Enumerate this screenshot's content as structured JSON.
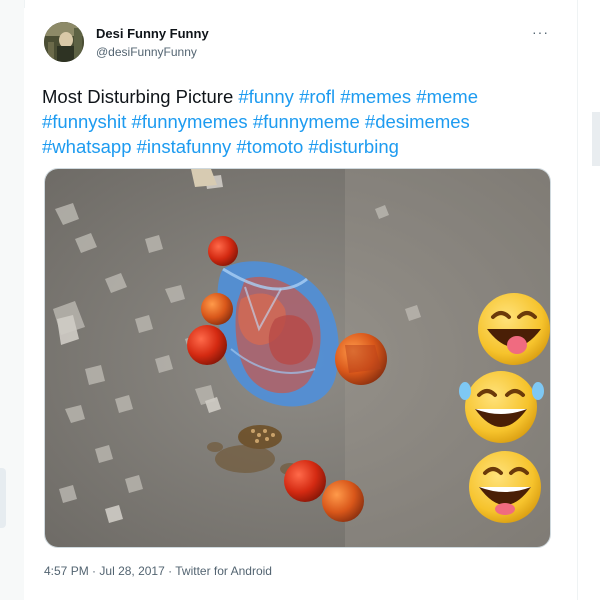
{
  "tweet": {
    "author_name": "Desi Funny Funny",
    "author_handle": "@desiFunnyFunny",
    "more_label": "···",
    "text_intro": "Most Disturbing Picture",
    "hashtags": [
      "#funny",
      "#rofl",
      "#memes",
      "#meme",
      "#funnyshit",
      "#funnymemes",
      "#funnymeme",
      "#desimemes",
      "#whatsapp",
      "#instafunny",
      "#tomoto",
      "#disturbing"
    ],
    "time": "4:57 PM",
    "date": "Jul 28, 2017",
    "source": "Twitter for Android",
    "separator": "·"
  },
  "colors": {
    "link": "#1d9bf0",
    "text": "#0f1419",
    "muted": "#536471",
    "emoji_yellow": "#f6c32c"
  },
  "icons": {
    "more": "more-horizontal-icon",
    "emojis": [
      "laughing-tongue-emoji",
      "laughing-tears-emoji",
      "laughing-emoji"
    ]
  }
}
